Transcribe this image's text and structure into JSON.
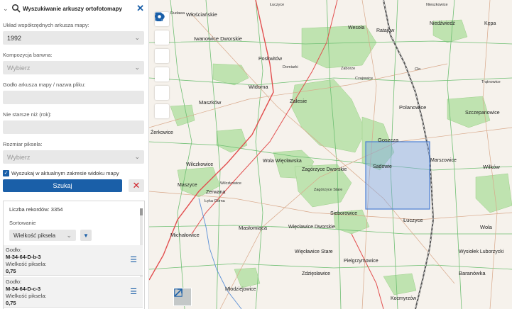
{
  "panel": {
    "title": "Wyszukiwanie arkuszy ortofotomapy",
    "fields": {
      "coord_label": "Układ współrzędnych arkusza mapy:",
      "coord_value": "1992",
      "color_label": "Kompozycja barwna:",
      "color_placeholder": "Wybierz",
      "sheet_label": "Godło arkusza mapy / nazwa pliku:",
      "age_label": "Nie starsze niż (rok):",
      "pixel_label": "Rozmiar piksela:",
      "pixel_placeholder": "Wybierz"
    },
    "checkbox_label": "Wyszukaj w aktualnym zakresie widoku mapy",
    "checkbox_checked": true,
    "search_button": "Szukaj",
    "clear_button": "✕"
  },
  "results": {
    "count_text": "Liczba rekordów: 3354",
    "sort_label": "Sortowanie",
    "sort_value": "Wielkość piksela",
    "records": [
      {
        "godlo_label": "Godło:",
        "godlo": "M-34-64-D-b-3",
        "pixel_label": "Wielkość piksela:",
        "pixel": "0,75"
      },
      {
        "godlo_label": "Godło:",
        "godlo": "M-34-64-D-c-3",
        "pixel_label": "Wielkość piksela:",
        "pixel": "0,75"
      }
    ]
  },
  "map": {
    "labels": {
      "l1": "Rudawa",
      "l2": "Łuczyce",
      "l3": "Nieszkowice",
      "l4": "Włościańskie",
      "l5": "Wesoła",
      "l6": "Ratajów",
      "l7": "Niedźwiedź",
      "l8": "Kępa",
      "l9": "Iwanowice Dworskie",
      "l10": "Poskwitów",
      "l11": "Domiarki",
      "l12": "Zaborze",
      "l13": "Widoma",
      "l14": "Maszków",
      "l15": "Zalesie",
      "l16": "Polanowice",
      "l17": "Szczepanowice",
      "l18": "Żerkowice",
      "l19": "Goszcza",
      "l20": "Marszowice",
      "l21": "Wilków",
      "l22": "Wola Więcławska",
      "l23": "Wilczkowice",
      "l24": "Zagórzyce Dworskie",
      "l25": "Sadowie",
      "l26": "Zerwana",
      "l27": "Zagórzyce Stare",
      "l28": "Maszyce",
      "l29": "Sieborowice",
      "l30": "Masłomiąca",
      "l31": "Więcławice Dworskie",
      "l32": "Łuczyce",
      "l33": "Michałowice",
      "l34": "Wola",
      "l35": "Więcławice Stare",
      "l36": "Pielgrzymowice",
      "l37": "Wysiołek Luborzycki",
      "l38": "Baranówka",
      "l39": "Zdzięsławice",
      "l40": "Młodziejowice",
      "l41": "Wilczkowice",
      "l42": "Cło",
      "l43": "Kocmyrzów",
      "l44": "Trątnowice",
      "l45": "Łęka Górna",
      "l46": "Czajowice"
    }
  }
}
